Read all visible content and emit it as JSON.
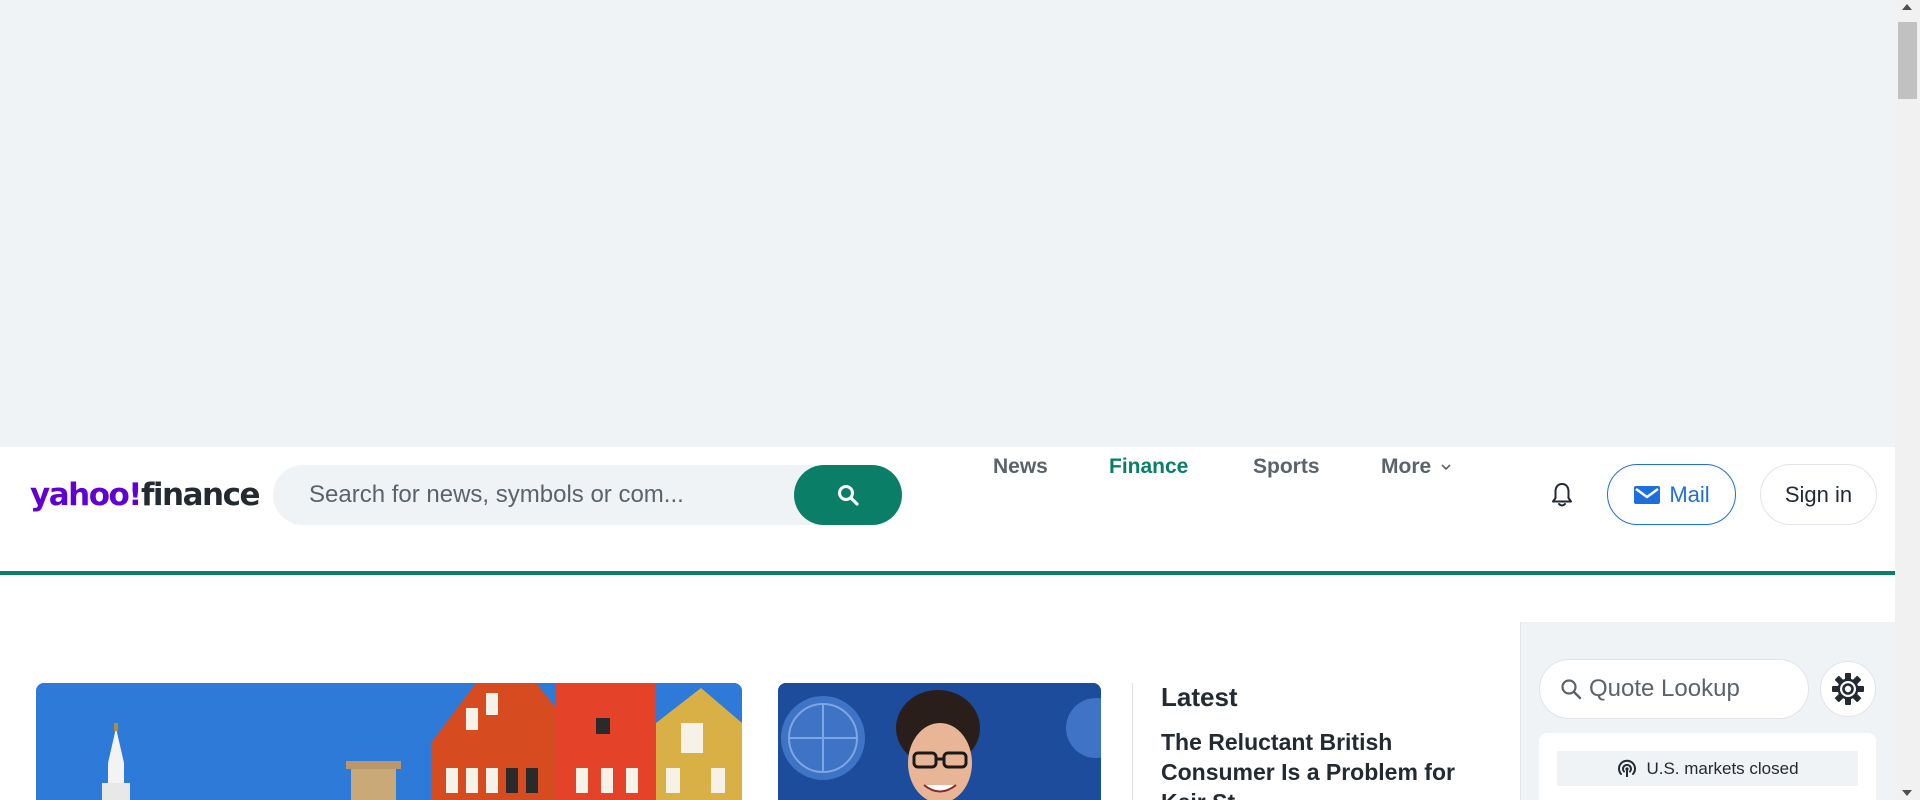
{
  "brand": {
    "logo_part1": "yahoo!",
    "logo_part2": "finance"
  },
  "search": {
    "placeholder": "Search for news, symbols or com...",
    "button_icon": "search-icon"
  },
  "nav": {
    "items": [
      {
        "label": "News"
      },
      {
        "label": "Finance"
      },
      {
        "label": "Sports"
      },
      {
        "label": "More"
      }
    ],
    "active_label": "Finance"
  },
  "header_actions": {
    "bell_icon": "bell-icon",
    "mail_label": "Mail",
    "signin_label": "Sign in"
  },
  "latest": {
    "heading": "Latest",
    "story_title": "The Reluctant British Consumer Is a Problem for Keir St..."
  },
  "right_rail": {
    "quote_placeholder": "Quote Lookup",
    "market_status": "U.S. markets closed"
  },
  "colors": {
    "brand_purple": "#6001d2",
    "finance_green": "#0b7e68",
    "mail_blue": "#1d6fdc",
    "ad_background": "#f0f3f5"
  }
}
